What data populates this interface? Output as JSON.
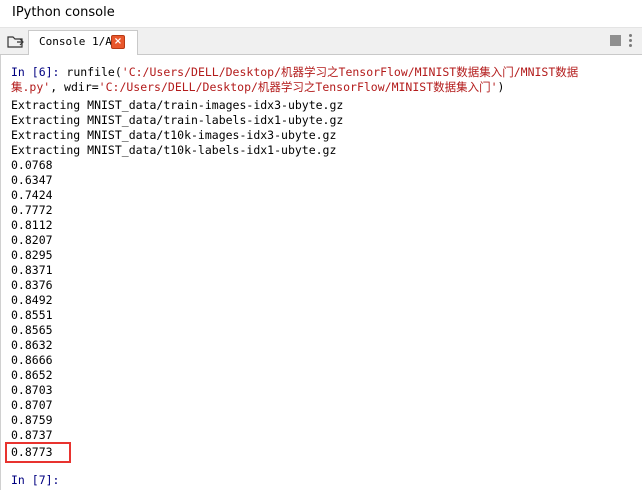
{
  "window": {
    "title": "IPython console"
  },
  "tabbar": {
    "browse_icon": "folder-browse-icon",
    "tab_label": "Console 1/A",
    "close_glyph": "×",
    "stop_icon": "stop-icon",
    "options_icon": "options-menu-icon"
  },
  "console": {
    "in6": {
      "prompt": "In [6]:",
      "func": " runfile(",
      "path1_part1": "'C:/Users/DELL/Desktop/机器学习之TensorFlow/MINIST数据集入门/MNIST数据",
      "path1_part2": "集.py'",
      "kw": ", wdir=",
      "path2": "'C:/Users/DELL/Desktop/机器学习之TensorFlow/MINIST数据集入门'",
      "close": ")"
    },
    "extracting": [
      "Extracting MNIST_data/train-images-idx3-ubyte.gz",
      "Extracting MNIST_data/train-labels-idx1-ubyte.gz",
      "Extracting MNIST_data/t10k-images-idx3-ubyte.gz",
      "Extracting MNIST_data/t10k-labels-idx1-ubyte.gz"
    ],
    "values": [
      "0.0768",
      "0.6347",
      "0.7424",
      "0.7772",
      "0.8112",
      "0.8207",
      "0.8295",
      "0.8371",
      "0.8376",
      "0.8492",
      "0.8551",
      "0.8565",
      "0.8632",
      "0.8666",
      "0.8652",
      "0.8703",
      "0.8707",
      "0.8759",
      "0.8737",
      "0.8773"
    ],
    "in7": {
      "prompt": "In [7]:"
    }
  },
  "colors": {
    "prompt": "#000080",
    "string": "#b31b1b",
    "highlight": "#e8332f",
    "close_button": "#e9572c"
  }
}
